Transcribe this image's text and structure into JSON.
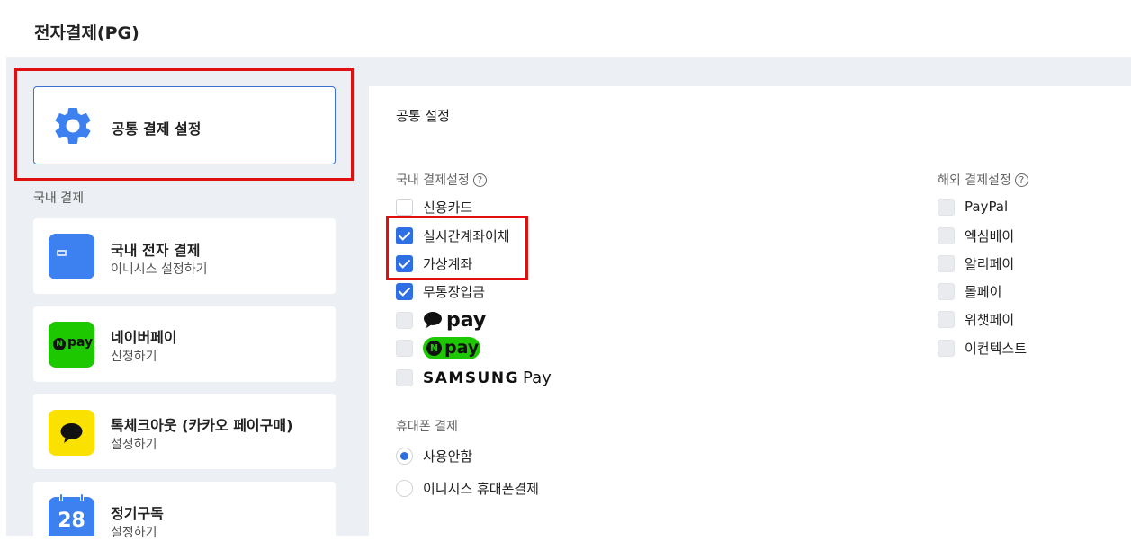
{
  "header": {
    "title": "전자결제(PG)"
  },
  "sidebar": {
    "common": {
      "label": "공통 결제 설정"
    },
    "section_domestic": "국내 결제",
    "cards": [
      {
        "title": "국내 전자 결제",
        "subtitle": "이니시스 설정하기",
        "icon": "card-icon"
      },
      {
        "title": "네이버페이",
        "subtitle": "신청하기",
        "icon": "npay-icon",
        "icon_text": "pay"
      },
      {
        "title": "톡체크아웃 (카카오 페이구매)",
        "subtitle": "설정하기",
        "icon": "kakao-talk-icon"
      },
      {
        "title": "정기구독",
        "subtitle": "설정하기",
        "icon": "calendar-icon",
        "icon_text": "28"
      }
    ]
  },
  "panel": {
    "title": "공통 설정",
    "domestic": {
      "label": "국내 결제설정",
      "help": "?",
      "options": [
        {
          "label": "신용카드",
          "checked": false
        },
        {
          "label": "실시간계좌이체",
          "checked": true
        },
        {
          "label": "가상계좌",
          "checked": true
        },
        {
          "label": "무통장입금",
          "checked": true
        }
      ],
      "logo_options": {
        "kakaopay": {
          "text": "pay",
          "checked": false
        },
        "naverpay": {
          "text": "pay",
          "badge": "N",
          "checked": false
        },
        "samsungpay": {
          "brand": "SAMSUNG",
          "text": "Pay",
          "checked": false
        }
      }
    },
    "foreign": {
      "label": "해외 결제설정",
      "help": "?",
      "options": [
        {
          "label": "PayPal",
          "checked": false
        },
        {
          "label": "엑심베이",
          "checked": false
        },
        {
          "label": "알리페이",
          "checked": false
        },
        {
          "label": "몰페이",
          "checked": false
        },
        {
          "label": "위챗페이",
          "checked": false
        },
        {
          "label": "이컨텍스트",
          "checked": false
        }
      ]
    },
    "mobile": {
      "label": "휴대폰 결제",
      "options": [
        {
          "label": "사용안함",
          "selected": true
        },
        {
          "label": "이니시스 휴대폰결제",
          "selected": false
        }
      ]
    }
  },
  "colors": {
    "accent": "#2f6fe4",
    "highlight": "#e01010",
    "npay_green": "#1ec800",
    "kakao_yellow": "#fae100"
  }
}
